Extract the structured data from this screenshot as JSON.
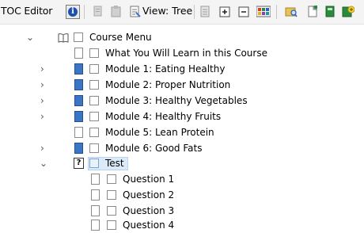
{
  "toolbar": {
    "title": "TOC Editor",
    "view_label": "View: Tree",
    "icons": [
      "info-icon",
      "cut-icon",
      "paste-icon",
      "view-tree-icon",
      "page-icon",
      "expand-icon",
      "collapse-icon",
      "color-grid-icon",
      "search-folder-icon",
      "new-page-icon",
      "book-icon",
      "add-icon"
    ]
  },
  "tree": {
    "root": {
      "label": "Course Menu",
      "icon": "book-icon"
    },
    "items": [
      {
        "label": "What You Will Learn in this Course",
        "icon": "page-blank",
        "expandable": false
      },
      {
        "label": "Module 1: Eating Healthy",
        "icon": "page-blue",
        "expandable": true
      },
      {
        "label": "Module 2: Proper Nutrition",
        "icon": "page-blue",
        "expandable": true
      },
      {
        "label": "Module 3: Healthy Vegetables",
        "icon": "page-blue",
        "expandable": true
      },
      {
        "label": "Module 4: Healthy Fruits",
        "icon": "page-blue",
        "expandable": true
      },
      {
        "label": "Module 5: Lean Protein",
        "icon": "page-blank",
        "expandable": false
      },
      {
        "label": "Module 6: Good Fats",
        "icon": "page-blue",
        "expandable": true
      },
      {
        "label": "Test",
        "icon": "question-page",
        "expandable": true,
        "expanded": true,
        "selected": true
      }
    ],
    "test_children": [
      {
        "label": "Question 1"
      },
      {
        "label": "Question 2"
      },
      {
        "label": "Question 3"
      },
      {
        "label": "Question 4"
      }
    ]
  },
  "colors": {
    "accent": "#1d4fb0",
    "module_page": "#3a76c4",
    "selection": "#dceaf8"
  }
}
